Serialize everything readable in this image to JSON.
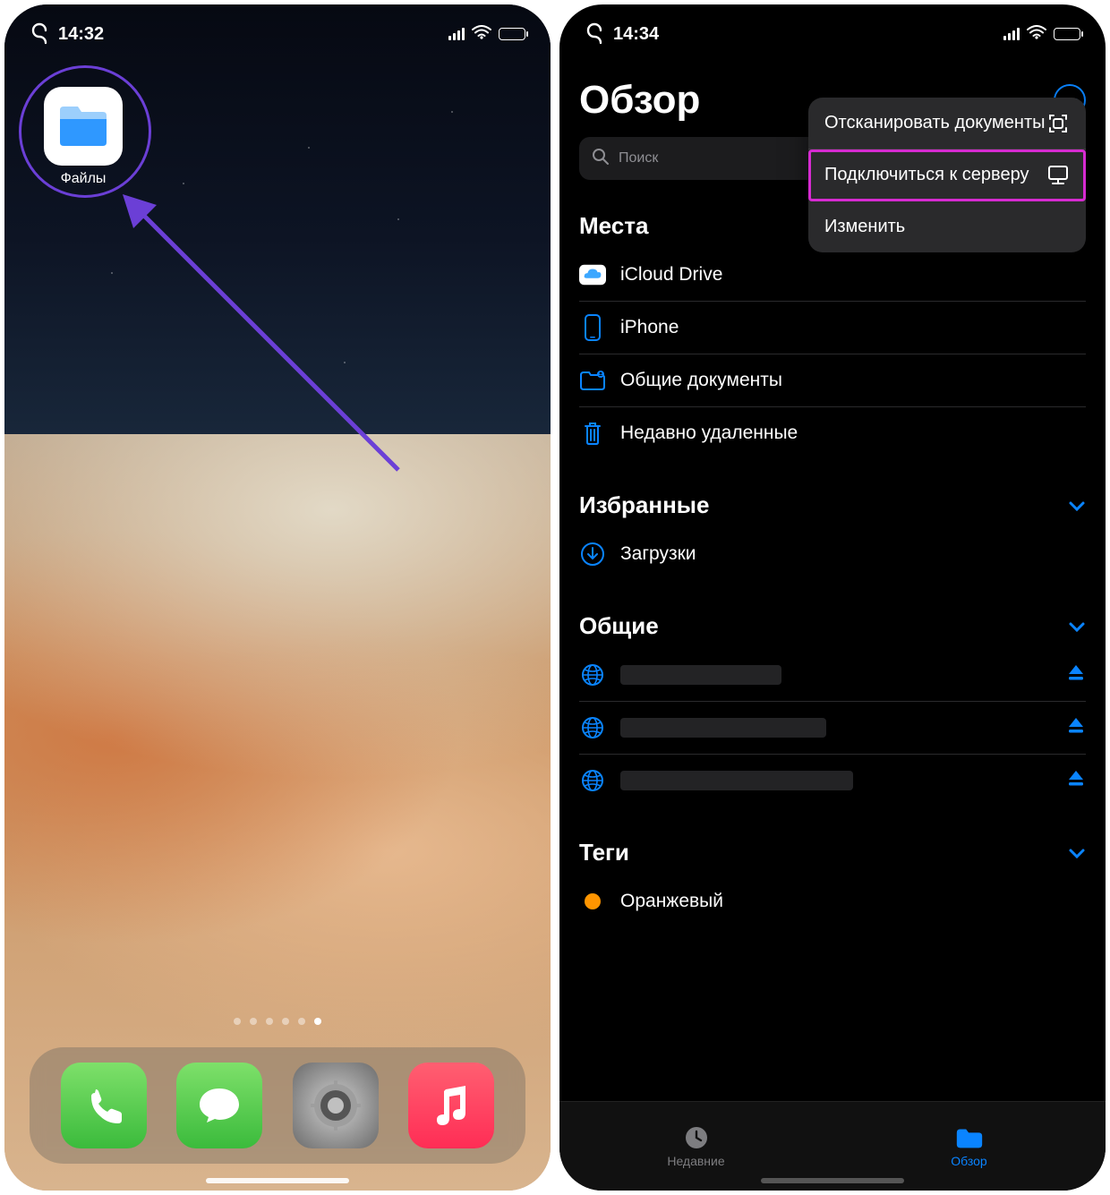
{
  "left": {
    "status_time": "14:32",
    "files_app_label": "Файлы"
  },
  "right": {
    "status_time": "14:34",
    "page_title": "Обзор",
    "search_placeholder": "Поиск",
    "menu": {
      "scan": "Отсканировать документы",
      "connect": "Подключиться к серверу",
      "edit": "Изменить"
    },
    "sections": {
      "places": {
        "title": "Места",
        "items": [
          "iCloud Drive",
          "iPhone",
          "Общие документы",
          "Недавно удаленные"
        ]
      },
      "favorites": {
        "title": "Избранные",
        "items": [
          "Загрузки"
        ]
      },
      "shared": {
        "title": "Общие"
      },
      "tags": {
        "title": "Теги",
        "items": [
          {
            "label": "Оранжевый",
            "color": "#ff9500"
          }
        ]
      }
    },
    "tabbar": {
      "recents": "Недавние",
      "browse": "Обзор"
    }
  }
}
